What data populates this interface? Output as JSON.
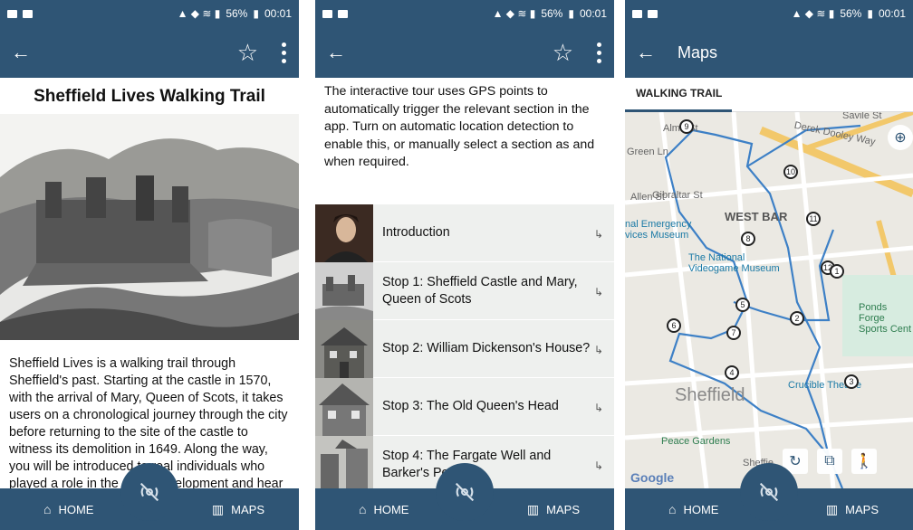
{
  "status_bar": {
    "battery": "56%",
    "time": "00:01"
  },
  "panel1": {
    "title": "Sheffield Lives Walking Trail",
    "body": "Sheffield Lives is a walking trail through Sheffield's past. Starting at the castle in 1570, with the arrival of Mary, Queen of Scots, it takes users on a chronological journey through the city before returning to the site of the castle to witness its demolition in 1649. Along the way, you will be introduced to real individuals who played a role in the city's development and hear"
  },
  "panel2": {
    "intro": "The interactive tour uses GPS points to automatically trigger the relevant section in the app. Turn on automatic location detection to enable this, or manually select a section as and when required.",
    "stops": [
      {
        "label": "Introduction"
      },
      {
        "label": "Stop 1: Sheffield Castle and Mary, Queen of Scots"
      },
      {
        "label": "Stop 2: William Dickenson's House?"
      },
      {
        "label": "Stop 3: The Old Queen's Head"
      },
      {
        "label": "Stop 4: The Fargate Well and Barker's Pool"
      }
    ]
  },
  "panel3": {
    "title": "Maps",
    "tab": "WALKING TRAIL",
    "map_labels": {
      "west_bar": "WEST BAR",
      "national_museum": "The National Videogame Museum",
      "emergency_museum": "nal Emergency vices Museum",
      "ponds_forge": "Ponds Forge Sports Cent",
      "crucible": "Crucible Theatre",
      "sheffield": "Sheffield",
      "peace_gardens": "Peace Gardens",
      "google": "Google",
      "derek_dooley": "Derek Dooley Way",
      "savile": "Savile St",
      "gibraltar": "Gibraltar St",
      "allen": "Allen St",
      "green_ln": "Green Ln",
      "alma": "Alma St",
      "sheffie": "Sheffie"
    },
    "markers": [
      "9",
      "10",
      "11",
      "8",
      "12",
      "1",
      "5",
      "2",
      "6",
      "7",
      "4",
      "3"
    ]
  },
  "nav": {
    "home": "HOME",
    "maps": "MAPS"
  }
}
